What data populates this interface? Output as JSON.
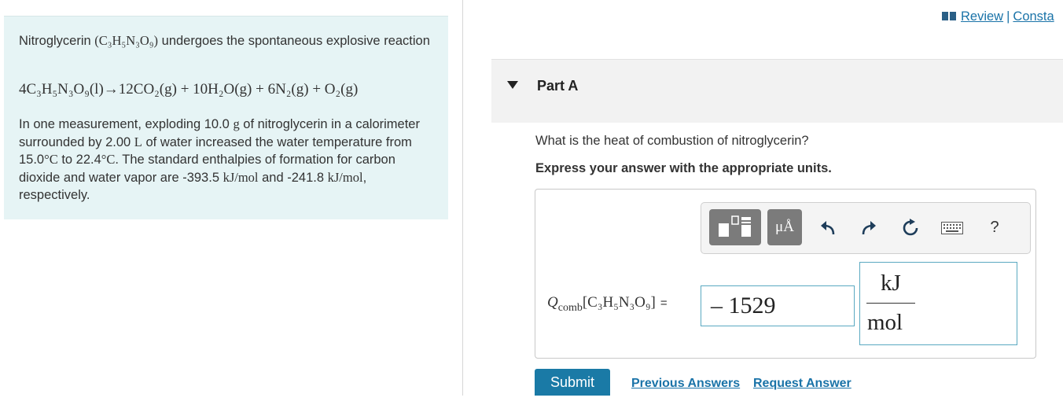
{
  "header": {
    "review_link": "Review",
    "separator": "|",
    "constants_link": "Consta"
  },
  "problem": {
    "intro_text": "Nitroglycerin",
    "intro_formula": "(C₃H₅N₃O₉)",
    "intro_rest": "undergoes the spontaneous explosive reaction",
    "equation": "4C₃H₅N₃O₉(l)→12CO₂(g) + 10H₂O(g) + 6N₂(g) + O₂(g)",
    "d1": "In one measurement, exploding 10.0",
    "d1u": "g",
    "d2": "of nitroglycerin in a calorimeter surrounded by 2.00",
    "d2u": "L",
    "d3": "of water increased the water temperature from 15.0",
    "d3u": "°C",
    "d4": "to 22.4",
    "d4u": "°C",
    "d5": ". The standard enthalpies of formation for carbon dioxide and water vapor are -393.5",
    "d5u": "kJ/mol",
    "d6": "and -241.8",
    "d6u": "kJ/mol",
    "d7": ", respectively."
  },
  "part": {
    "title": "Part A",
    "question": "What is the heat of combustion of nitroglycerin?",
    "instruction": "Express your answer with the appropriate units."
  },
  "toolbar": {
    "units_label": "μÅ",
    "help_label": "?",
    "icons": [
      "template-icon",
      "units-icon",
      "undo-icon",
      "redo-icon",
      "reset-icon",
      "keyboard-icon",
      "help-icon"
    ]
  },
  "answer": {
    "label_main": "Q",
    "label_sub": "comb",
    "label_formula": "[C₃H₅N₃O₉]",
    "label_eq": "=",
    "value": "– 1529",
    "unit_numerator": "kJ",
    "unit_denominator": "mol"
  },
  "actions": {
    "submit_label": "Submit",
    "previous_answers_label": "Previous Answers",
    "request_answer_label": "Request Answer"
  },
  "colors": {
    "panel_bg": "#e6f4f5",
    "link": "#1a73a8",
    "submit_bg": "#1a7aa6",
    "input_border": "#5aa9c1"
  }
}
